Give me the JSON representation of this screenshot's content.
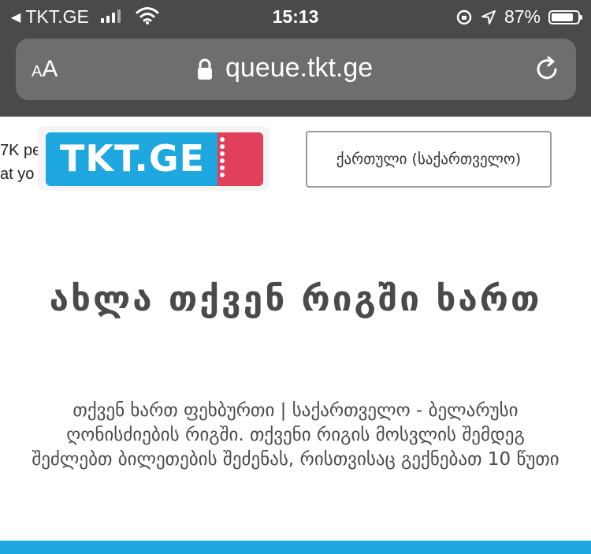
{
  "status_bar": {
    "back_app": "TKT.GE",
    "time": "15:13",
    "battery": "87%",
    "battery_level": 0.87
  },
  "browser": {
    "text_size_small": "A",
    "text_size_large": "A",
    "url": "queue.tkt.ge"
  },
  "page": {
    "left_cut_line1": "7K pe",
    "left_cut_line2": "at yo",
    "logo_text": "TKT.GE",
    "language_button": "ქართული (საქართველო)",
    "heading": "ახლა თქვენ რიგში ხართ",
    "body": "თქვენ ხართ ფეხბურთი | საქართველო - ბელარუსი ღონისძიების რიგში. თქვენი რიგის მოსვლის შემდეგ შეძლებთ ბილეთების შეძენას, რისთვისაც გექნებათ 10 წუთი"
  },
  "colors": {
    "chrome": "#4a4a4a",
    "urlbar": "#6e6e6e",
    "brand_blue": "#1fa7df",
    "brand_red": "#e0405a"
  }
}
